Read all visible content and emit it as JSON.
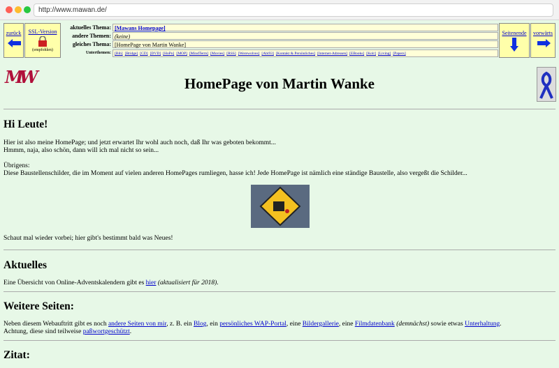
{
  "browser": {
    "url": "http://www.mawan.de/"
  },
  "nav": {
    "back_label": "zurück",
    "ssl_label": "SSL-Version",
    "ssl_note": "(empfohlen)",
    "page_end_label": "Seitenende",
    "forward_label": "vorwärts",
    "rows": [
      {
        "label": "aktuelles Thema:",
        "value": "[Mawans Homepage]"
      },
      {
        "label": "andere Themen:",
        "value": "(keine)"
      },
      {
        "label": "gleiches Thema:",
        "value": "[HomePage von Martin Wanke]"
      }
    ],
    "subtopics_label": "Unterthemen:",
    "subtopics": [
      "[Bib]",
      "[Bridge]",
      "[CD]",
      "[DVD]",
      "[HoPo]",
      "[MOP]",
      "[MindTerm]",
      "[Movies]",
      "[RSS]",
      "[Werewolves]",
      "[Abi93]",
      "[Kontakt & Persönliches]",
      "[Internet-Adressen]",
      "[EBooks]",
      "[Kolr]",
      "[Living]",
      "[Papers]"
    ]
  },
  "header": {
    "title": "HomePage von Martin Wanke",
    "logo": "MW"
  },
  "intro": {
    "heading": "Hi Leute!",
    "line1": "Hier ist also meine HomePage; und jetzt erwartet Ihr wohl auch noch, daß Ihr was geboten bekommt...",
    "line2": "Hmmm, naja, also schön, dann will ich mal nicht so sein...",
    "line3": "Übrigens:",
    "line4": "Diese Baustellenschilder, die im Moment auf vielen anderen HomePages rumliegen, hasse ich! Jede HomePage ist nämlich eine ständige Baustelle, also vergeßt die Schilder...",
    "line5": "Schaut mal wieder vorbei; hier gibt's bestimmt bald was Neues!"
  },
  "aktuelles": {
    "heading": "Aktuelles",
    "text_before": "Eine Übersicht von Online-Adventskalendern gibt es ",
    "link": "hier",
    "text_italic": "(aktualisiert für 2018)",
    "text_after": "."
  },
  "weitere": {
    "heading": "Weitere Seiten:",
    "t1": "Neben diesem Webauftritt gibt es noch ",
    "l1": "andere Seiten von mir",
    "t2": ", z. B. ein ",
    "l2": "Blog",
    "t3": ", ein ",
    "l3": "persönliches WAP-Portal",
    "t4": ", eine ",
    "l4": "Bildergallerie",
    "t5": ", eine ",
    "l5": "Filmdatenbank",
    "t6": "(demnächst)",
    "t7": " sowie etwas ",
    "l6": "Unterhaltung",
    "t8": ".",
    "t9": "Achtung, diese sind teilweise ",
    "l7": "paßwortgeschützt",
    "t10": "."
  },
  "zitat": {
    "heading": "Zitat:"
  },
  "colors": {
    "background": "#e7f8e7",
    "nav_bg": "#ffffaa",
    "link": "#0000cc"
  }
}
